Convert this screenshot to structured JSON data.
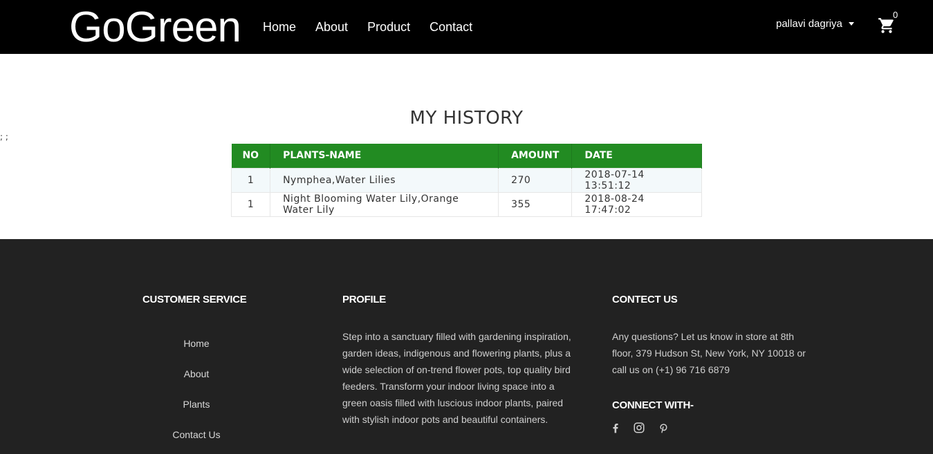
{
  "brand": "GoGreen",
  "nav": [
    "Home",
    "About",
    "Product",
    "Contact"
  ],
  "user": {
    "name": "pallavi dagriya"
  },
  "cart": {
    "count": "0"
  },
  "stray_text": "; ;",
  "history": {
    "title": "MY HISTORY",
    "columns": [
      "NO",
      "PLANTS-NAME",
      "AMOUNT",
      "DATE"
    ],
    "rows": [
      [
        "1",
        "Nymphea,Water Lilies",
        "270",
        "2018-07-14 13:51:12"
      ],
      [
        "1",
        "Night Blooming Water Lily,Orange Water Lily",
        "355",
        "2018-08-24 17:47:02"
      ]
    ]
  },
  "footer": {
    "customer_service": {
      "heading": "CUSTOMER SERVICE",
      "links": [
        "Home",
        "About",
        "Plants",
        "Contact Us"
      ]
    },
    "profile": {
      "heading": "PROFILE",
      "lines": [
        "Step into a sanctuary filled with gardening inspiration,",
        "garden ideas, indigenous and flowering plants, plus a",
        "wide selection of on-trend flower pots, top quality bird",
        "feeders. Transform your indoor living space into a",
        "green oasis filled with luscious indoor plants, paired",
        "with stylish indoor pots and beautiful containers."
      ]
    },
    "contact": {
      "heading": "CONTECT US",
      "lines": [
        "Any questions? Let us know in store at 8th",
        "floor, 379 Hudson St, New York, NY 10018 or",
        "call us on (+1) 96 716 6879"
      ],
      "connect_heading": "CONNECT WITH-",
      "social_icons": [
        "facebook-icon",
        "instagram-icon",
        "pinterest-icon"
      ]
    }
  },
  "colors": {
    "navbar_bg": "#000000",
    "table_header_bg": "#228b22",
    "footer_bg": "#222222"
  }
}
